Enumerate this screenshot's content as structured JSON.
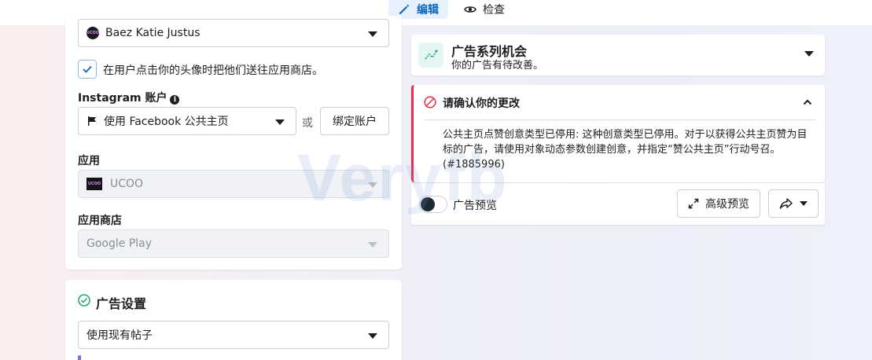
{
  "toolbar": {
    "edit_tab": "编辑",
    "inspect_tab": "检查"
  },
  "identity": {
    "page_name": "Baez Katie Justus",
    "page_avatar_text": "UCOO",
    "send_to_store_checkbox": "在用户点击你的头像时把他们送往应用商店。",
    "send_to_store_checked": true,
    "instagram_label": "Instagram 账户",
    "instagram_value": "使用 Facebook 公共主页",
    "or_text": "或",
    "bind_account_button": "绑定账户",
    "app_label": "应用",
    "app_value": "UCOO",
    "app_icon_text": "UCOO",
    "store_label": "应用商店",
    "store_value": "Google Play"
  },
  "ad_settings": {
    "title": "广告设置",
    "post_select_value": "使用现有帖子"
  },
  "opportunity": {
    "title": "广告系列机会",
    "subtitle": "你的广告有待改善。"
  },
  "error": {
    "title": "请确认你的更改",
    "message": "公共主页点赞创意类型已停用: 这种创意类型已停用。对于以获得公共主页赞为目标的广告，请使用对象动态参数创建创意，并指定“赞公共主页”行动号召。 (#1885996)"
  },
  "preview": {
    "toggle_label": "广告预览",
    "advanced_button": "高级预览"
  },
  "watermark": "Veryfb",
  "colors": {
    "accent": "#0866c2",
    "error": "#e0314b",
    "opportunity_icon": "#1fb28a"
  }
}
